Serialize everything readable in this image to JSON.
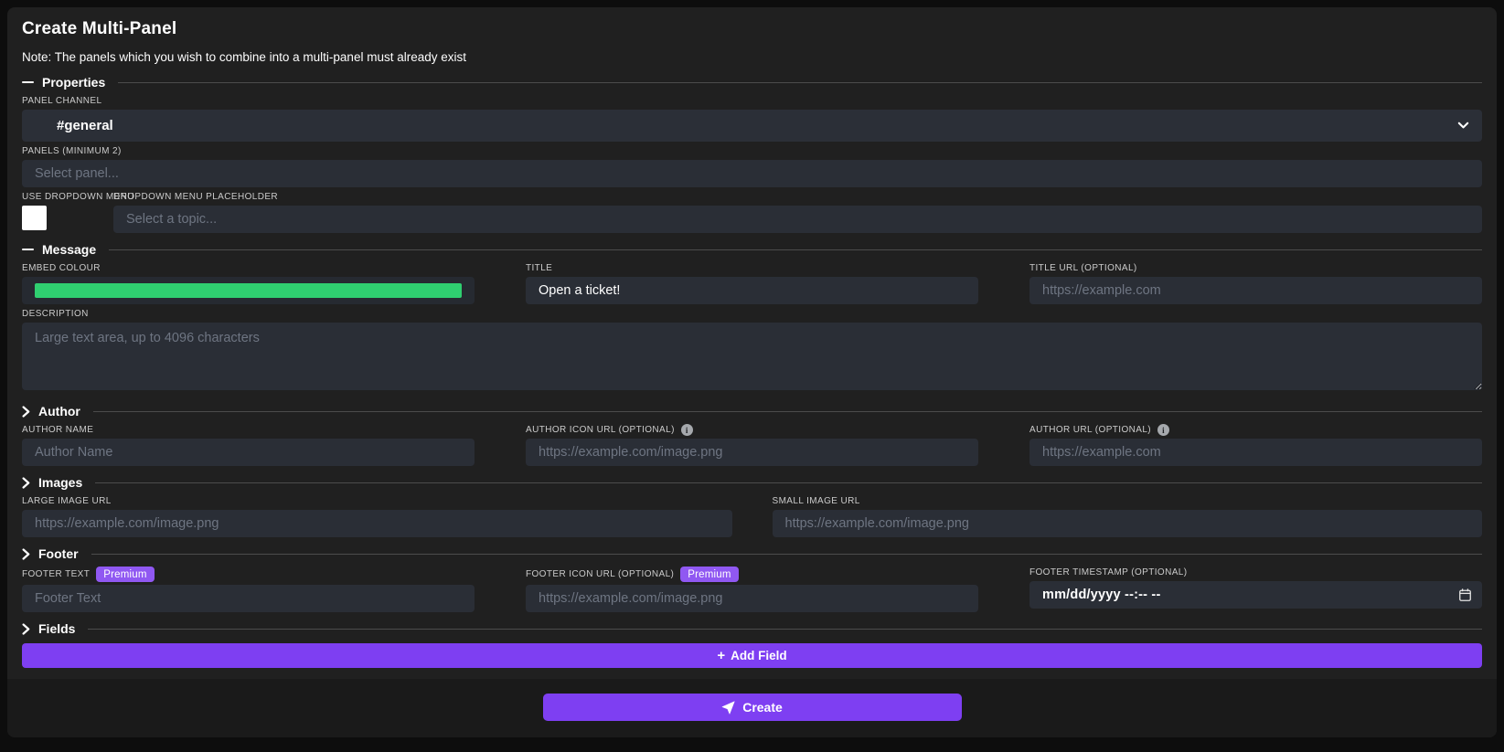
{
  "page": {
    "title": "Create Multi-Panel",
    "note": "Note: The panels which you wish to combine into a multi-panel must already exist"
  },
  "colors": {
    "accent_purple": "#7e3ff2",
    "badge_purple": "#9058f2",
    "embed_green": "#2fcf70",
    "card_bg": "#202020",
    "input_bg": "#2a2e36"
  },
  "sections": {
    "properties": {
      "label": "Properties",
      "state": "expanded"
    },
    "message": {
      "label": "Message",
      "state": "expanded"
    },
    "author": {
      "label": "Author",
      "state": "collapsed"
    },
    "images": {
      "label": "Images",
      "state": "collapsed"
    },
    "footer": {
      "label": "Footer",
      "state": "collapsed"
    },
    "fields": {
      "label": "Fields",
      "state": "collapsed"
    }
  },
  "properties": {
    "panel_channel": {
      "label": "PANEL CHANNEL",
      "value": "#general"
    },
    "panels": {
      "label": "PANELS (MINIMUM 2)",
      "placeholder": "Select panel..."
    },
    "use_dropdown_menu": {
      "label": "USE DROPDOWN MENU",
      "checked": false
    },
    "dropdown_placeholder": {
      "label": "DROPDOWN MENU PLACEHOLDER",
      "placeholder": "Select a topic..."
    }
  },
  "message": {
    "embed_colour": {
      "label": "EMBED COLOUR"
    },
    "title": {
      "label": "TITLE",
      "value": "Open a ticket!"
    },
    "title_url": {
      "label": "TITLE URL (OPTIONAL)",
      "placeholder": "https://example.com"
    },
    "description": {
      "label": "DESCRIPTION",
      "placeholder": "Large text area, up to 4096 characters"
    }
  },
  "author": {
    "name": {
      "label": "AUTHOR NAME",
      "placeholder": "Author Name"
    },
    "icon_url": {
      "label": "AUTHOR ICON URL (OPTIONAL)",
      "placeholder": "https://example.com/image.png"
    },
    "url": {
      "label": "AUTHOR URL (OPTIONAL)",
      "placeholder": "https://example.com"
    }
  },
  "images": {
    "large_image": {
      "label": "LARGE IMAGE URL",
      "placeholder": "https://example.com/image.png"
    },
    "small_image": {
      "label": "SMALL IMAGE URL",
      "placeholder": "https://example.com/image.png"
    }
  },
  "footer": {
    "text": {
      "label": "FOOTER TEXT",
      "badge": "Premium",
      "placeholder": "Footer Text"
    },
    "icon_url": {
      "label": "FOOTER ICON URL (OPTIONAL)",
      "badge": "Premium",
      "placeholder": "https://example.com/image.png"
    },
    "timestamp": {
      "label": "FOOTER TIMESTAMP (OPTIONAL)",
      "value": "mm/dd/yyyy --:-- --"
    }
  },
  "actions": {
    "add_field": {
      "label": "Add Field",
      "icon": "+"
    },
    "create": {
      "label": "Create"
    }
  }
}
